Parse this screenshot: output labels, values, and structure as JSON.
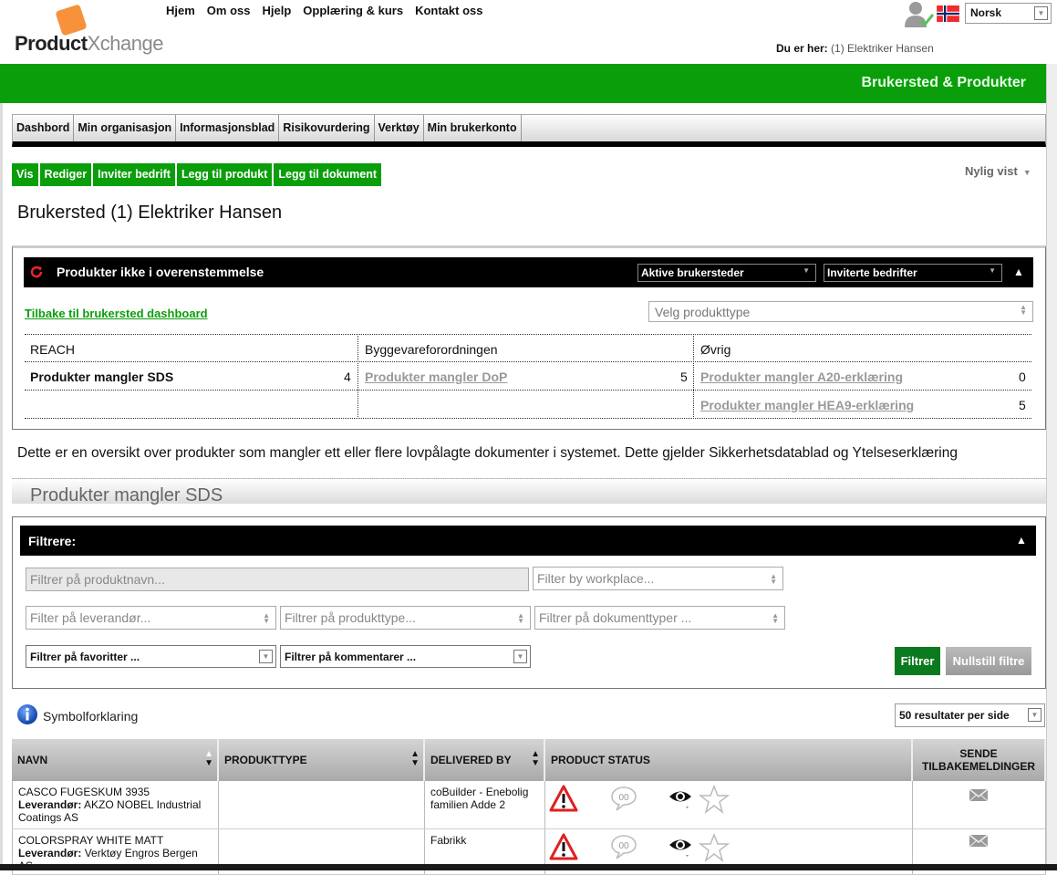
{
  "header": {
    "logo_bold": "Product",
    "logo_light": "Xchange",
    "topnav": [
      "Hjem",
      "Om oss",
      "Hjelp",
      "Opplæring & kurs",
      "Kontakt oss"
    ],
    "language": "Norsk",
    "breadcrumb_label": "Du er her:",
    "breadcrumb_value": "(1) Elektriker Hansen",
    "section_title": "Brukersted & Produkter"
  },
  "mainnav": [
    "Dashbord",
    "Min organisasjon",
    "Informasjonsblad",
    "Risikovurdering",
    "Verktøy",
    "Min brukerkonto"
  ],
  "actions": [
    "Vis",
    "Rediger",
    "Inviter bedrift",
    "Legg til produkt",
    "Legg til dokument"
  ],
  "recent": "Nylig vist",
  "page_title": "Brukersted (1) Elektriker Hansen",
  "compliance": {
    "title": "Produkter ikke i overenstemmelse",
    "dropdown_workplaces": "Aktive brukersteder",
    "dropdown_companies": "Inviterte bedrifter",
    "back_link": "Tilbake til brukersted dashboard",
    "product_type_placeholder": "Velg produkttype",
    "columns": [
      {
        "header": "REACH",
        "items": [
          {
            "label": "Produkter mangler SDS",
            "count": "4",
            "active": true
          }
        ]
      },
      {
        "header": "Byggevareforordningen",
        "items": [
          {
            "label": "Produkter mangler DoP",
            "count": "5",
            "active": false
          }
        ]
      },
      {
        "header": "Øvrig",
        "items": [
          {
            "label": "Produkter mangler A20-erklæring",
            "count": "0",
            "active": false
          },
          {
            "label": "Produkter mangler HEA9-erklæring",
            "count": "5",
            "active": false
          }
        ]
      }
    ]
  },
  "description": "Dette er en oversikt over produkter som mangler ett eller flere lovpålagte dokumenter i systemet. Dette gjelder Sikkerhetsdatablad og Ytelseserklæring",
  "section_title": "Produkter mangler SDS",
  "filters": {
    "title": "Filtrere:",
    "product_name_placeholder": "Filtrer på produktnavn...",
    "workplace_placeholder": "Filter by workplace...",
    "supplier_placeholder": "Filter på leverandør...",
    "product_type_placeholder": "Filtrer på produkttype...",
    "document_type_placeholder": "Filtrer på dokumenttyper ...",
    "favorites_select": "Filtrer på favoritter ...",
    "comments_select": "Filtrer på kommentarer ...",
    "filter_button": "Filtrer",
    "reset_button": "Nullstill filtre"
  },
  "legend_link": "Symbolforklaring",
  "per_page": "50 resultater per side",
  "table": {
    "headers": [
      "NAVN",
      "PRODUKTTYPE",
      "DELIVERED BY",
      "PRODUCT STATUS",
      "SENDE TILBAKEMELDINGER"
    ],
    "supplier_label": "Leverandør:",
    "rows": [
      {
        "name": "CASCO FUGESKUM 3935",
        "supplier": "AKZO NOBEL Industrial Coatings AS",
        "product_type": "",
        "delivered_by": "coBuilder - Enebolig familien Adde 2",
        "comments": "00"
      },
      {
        "name": "COLORSPRAY WHITE MATT",
        "supplier": "Verktøy Engros Bergen AS",
        "product_type": "",
        "delivered_by": "Fabrikk",
        "comments": "00"
      }
    ]
  },
  "colors": {
    "brand_green": "#0b9e0b",
    "logo_orange": "#f7913a",
    "filter_button": "#0b7a1e",
    "warning_red": "#e02020"
  }
}
